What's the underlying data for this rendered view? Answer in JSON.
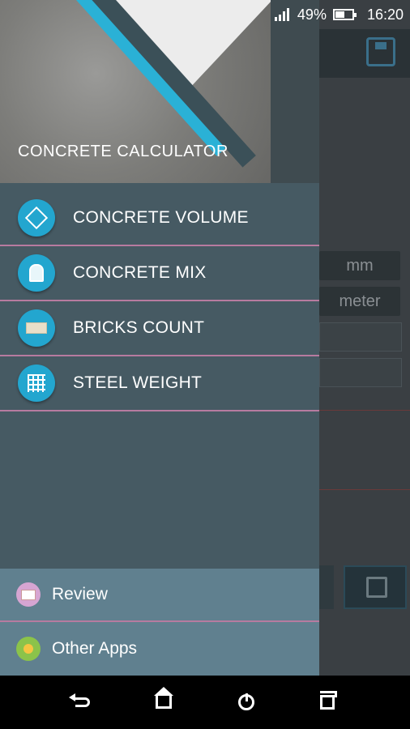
{
  "status_bar": {
    "battery_percent": "49%",
    "time": "16:20"
  },
  "background_app": {
    "units": [
      "mm",
      "meter"
    ]
  },
  "drawer": {
    "header_title": "CONCRETE CALCULATOR",
    "menu_items": [
      {
        "label": "CONCRETE VOLUME",
        "icon": "cube-icon"
      },
      {
        "label": "CONCRETE MIX",
        "icon": "mixer-icon"
      },
      {
        "label": "BRICKS COUNT",
        "icon": "brick-icon"
      },
      {
        "label": "STEEL WEIGHT",
        "icon": "steel-mesh-icon"
      }
    ],
    "footer_items": [
      {
        "label": "Review",
        "icon": "envelope-icon"
      },
      {
        "label": "Other Apps",
        "icon": "medal-icon"
      }
    ]
  },
  "colors": {
    "drawer_bg": "#465a63",
    "accent_cyan": "#23a6cf",
    "divider_pink": "#b77ba0",
    "footer_bg": "#60808f"
  }
}
